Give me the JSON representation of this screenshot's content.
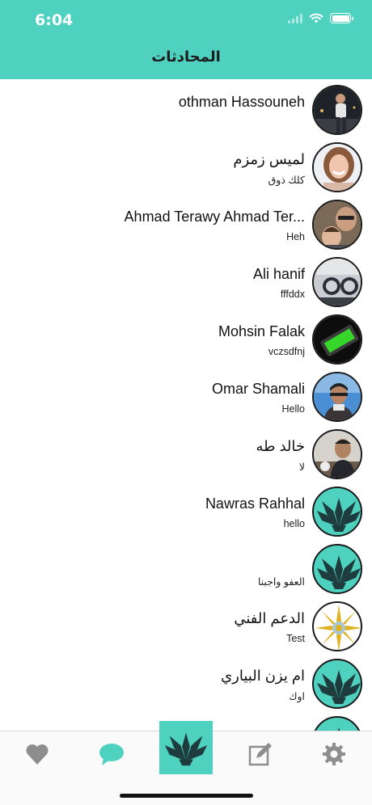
{
  "status_bar": {
    "time": "6:04"
  },
  "header": {
    "title": "المحادثات"
  },
  "conversations": [
    {
      "name": "othman Hassouneh",
      "message": "",
      "avatar": "photo-man-night"
    },
    {
      "name": "لميس زمزم",
      "message": "كلك ذوق",
      "avatar": "photo-woman-smiling"
    },
    {
      "name": "Ahmad Terawy  Ahmad Ter...",
      "message": "Heh",
      "avatar": "photo-man-child"
    },
    {
      "name": "Ali hanif",
      "message": "fffddx",
      "avatar": "photo-car-dashboard"
    },
    {
      "name": "Mohsin Falak",
      "message": "vczsdfnj",
      "avatar": "photo-green-screen"
    },
    {
      "name": "Omar Shamali",
      "message": "Hello",
      "avatar": "photo-man-sky"
    },
    {
      "name": "خالد طه",
      "message": "لا",
      "avatar": "photo-man-restaurant"
    },
    {
      "name": "Nawras Rahhal",
      "message": "hello",
      "avatar": "app-logo-plant"
    },
    {
      "name": "",
      "message": "العفو واجبنا",
      "avatar": "app-logo-plant"
    },
    {
      "name": "الدعم الفني",
      "message": "Test",
      "avatar": "sun-emblem"
    },
    {
      "name": "ام يزن البياري",
      "message": "اوك",
      "avatar": "app-logo-plant"
    },
    {
      "name": "",
      "message": "",
      "avatar": "app-logo-plant"
    }
  ],
  "tab_bar": {
    "items": [
      {
        "icon": "heart-icon",
        "active": false
      },
      {
        "icon": "chat-bubble-icon",
        "active": true
      },
      {
        "icon": "app-logo-icon",
        "active": false
      },
      {
        "icon": "compose-icon",
        "active": false
      },
      {
        "icon": "gear-icon",
        "active": false
      }
    ]
  },
  "colors": {
    "brand": "#4fd1c0",
    "tab_inactive": "#8e8e8e",
    "tab_active": "#4fd1c0"
  }
}
